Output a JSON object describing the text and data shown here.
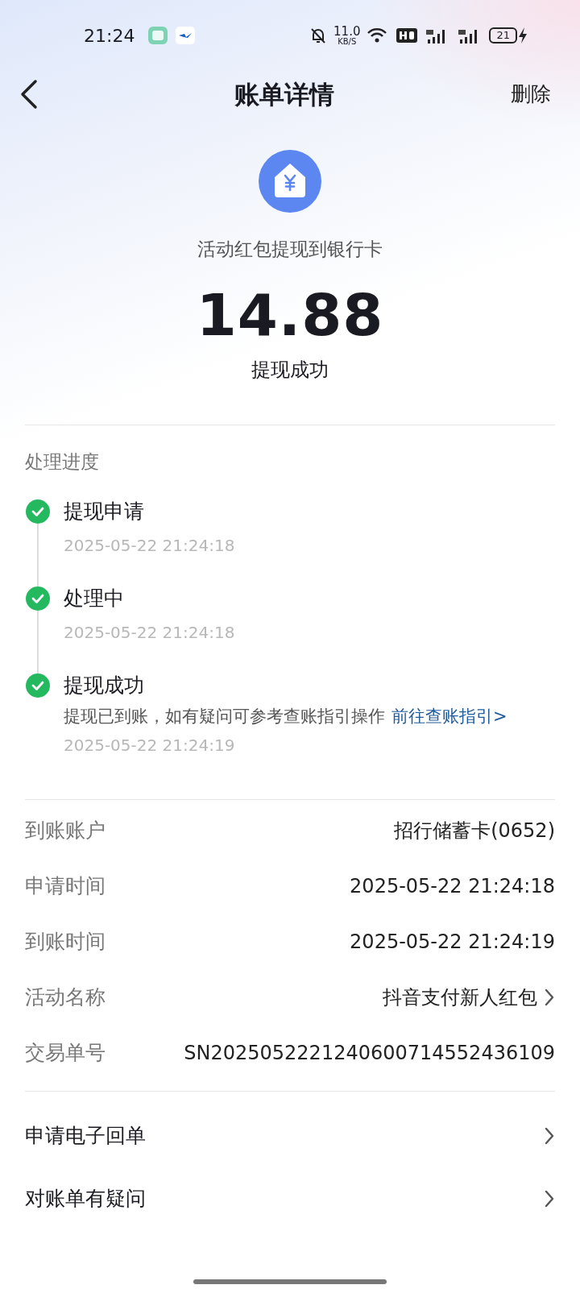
{
  "status_bar": {
    "time": "21:24",
    "speed": "11.0",
    "speed_unit": "KB/S",
    "battery": "21"
  },
  "header": {
    "title": "账单详情",
    "action": "删除"
  },
  "summary": {
    "description": "活动红包提现到银行卡",
    "amount": "14.88",
    "status": "提现成功"
  },
  "progress": {
    "heading": "处理进度",
    "steps": [
      {
        "title": "提现申请",
        "done": true,
        "time": "2025-05-22 21:24:18"
      },
      {
        "title": "处理中",
        "done": true,
        "time": "2025-05-22 21:24:18"
      },
      {
        "title": "提现成功",
        "done": true,
        "note": "提现已到账，如有疑问可参考查账指引操作",
        "link": "前往查账指引>",
        "time": "2025-05-22 21:24:19"
      }
    ]
  },
  "details": [
    {
      "label": "到账账户",
      "value": "招行储蓄卡(0652)",
      "chevron": false
    },
    {
      "label": "申请时间",
      "value": "2025-05-22 21:24:18",
      "chevron": false
    },
    {
      "label": "到账时间",
      "value": "2025-05-22 21:24:19",
      "chevron": false
    },
    {
      "label": "活动名称",
      "value": "抖音支付新人红包",
      "chevron": true
    },
    {
      "label": "交易单号",
      "value": "SN2025052221240600714552436109",
      "chevron": false
    }
  ],
  "actions": [
    {
      "label": "申请电子回单"
    },
    {
      "label": "对账单有疑问"
    }
  ]
}
